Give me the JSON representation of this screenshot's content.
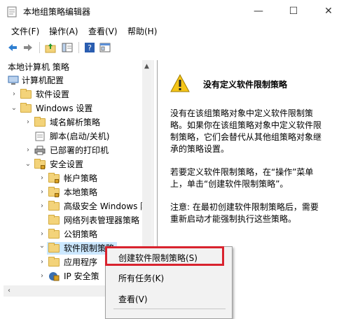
{
  "window": {
    "title": "本地组策略编辑器",
    "controls": {
      "minimize": "—",
      "maximize": "☐",
      "close": "✕"
    }
  },
  "menu": {
    "file": "文件(F)",
    "action": "操作(A)",
    "view": "查看(V)",
    "help": "帮助(H)"
  },
  "toolbar": [
    "back-icon",
    "forward-icon",
    "up-folder-icon",
    "show-hide-tree-icon",
    "help-icon",
    "properties-icon"
  ],
  "tree": {
    "root": "本地计算机 策略",
    "items": [
      {
        "label": "计算机配置"
      },
      {
        "label": "软件设置"
      },
      {
        "label": "Windows 设置"
      },
      {
        "label": "域名解析策略"
      },
      {
        "label": "脚本(启动/关机)"
      },
      {
        "label": "已部署的打印机"
      },
      {
        "label": "安全设置"
      },
      {
        "label": "帐户策略"
      },
      {
        "label": "本地策略"
      },
      {
        "label": "高级安全 Windows 防"
      },
      {
        "label": "网络列表管理器策略"
      },
      {
        "label": "公钥策略"
      },
      {
        "label": "软件限制策略"
      },
      {
        "label": "应用程序"
      },
      {
        "label": "IP 安全策"
      }
    ]
  },
  "detail": {
    "heading": "没有定义软件限制策略",
    "para1": "没有在该组策略对象中定义软件限制策略。如果你在该组策略对象中定义软件限制策略，它们会替代从其他组策略对象继承的策略设置。",
    "para2": "若要定义软件限制策略，在“操作”菜单上，单击“创建软件限制策略”。",
    "para3": "注意: 在最初创建软件限制策略后，需要重新启动才能强制执行这些策略。"
  },
  "context_menu": {
    "create": "创建软件限制策略(S)",
    "all_tasks": "所有任务(K)",
    "view": "查看(V)",
    "highlight_color": "#d9232e"
  }
}
